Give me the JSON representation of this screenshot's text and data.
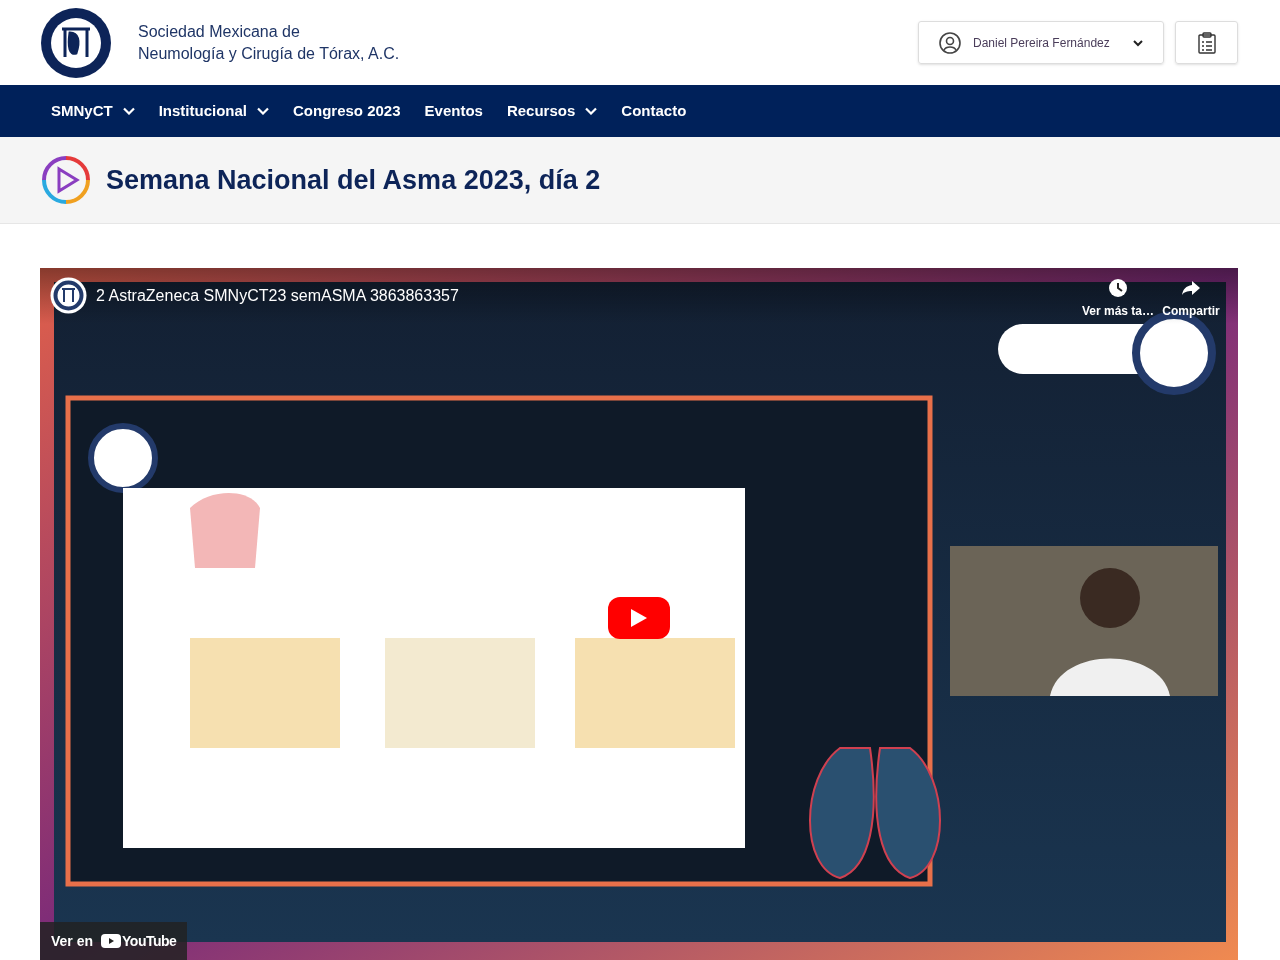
{
  "header": {
    "org_name_line1": "Sociedad Mexicana de",
    "org_name_line2": "Neumología y Cirugía de Tórax, A.C.",
    "user_menu": {
      "label": "Daniel Pereira Fernández"
    }
  },
  "nav": [
    {
      "label": "SMNyCT",
      "has_menu": true
    },
    {
      "label": "Institucional",
      "has_menu": true
    },
    {
      "label": "Congreso 2023",
      "has_menu": false
    },
    {
      "label": "Eventos",
      "has_menu": false
    },
    {
      "label": "Recursos",
      "has_menu": true
    },
    {
      "label": "Contacto",
      "has_menu": false
    }
  ],
  "page_title": "Semana Nacional del Asma 2023, día 2",
  "video": {
    "title": "2 AstraZeneca SMNyCT23 semASMA 3863863357",
    "actions": [
      {
        "kind": "watch_later",
        "label": "Ver más ta…"
      },
      {
        "kind": "share",
        "label": "Compartir"
      }
    ],
    "watch_on": "Ver en",
    "brand": "YouTube"
  }
}
